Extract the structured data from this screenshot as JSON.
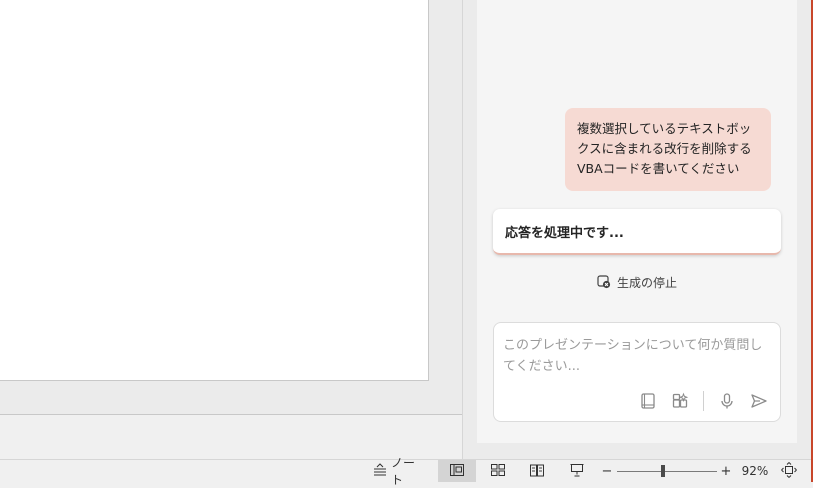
{
  "copilot": {
    "user_message": "複数選択しているテキストボックスに含まれる改行を削除するVBAコードを書いてください",
    "response_status": "応答を処理中です...",
    "stop_label": "生成の停止",
    "input_placeholder": "このプレゼンテーションについて何か質問してください..."
  },
  "status_bar": {
    "notes_label": "ノート",
    "zoom_out": "−",
    "zoom_in": "+",
    "zoom_level": "92%",
    "zoom_percent": 92
  },
  "colors": {
    "user_bubble": "#f6dad3",
    "accent": "#c8462a"
  },
  "icons": {
    "stop": "stop-generating-icon",
    "notebook": "notebook-icon",
    "prompt_gallery": "prompt-gallery-icon",
    "microphone": "microphone-icon",
    "send": "send-icon",
    "notes": "notes-icon",
    "normal_view": "normal-view-icon",
    "slide_sorter": "slide-sorter-icon",
    "reading_view": "reading-view-icon",
    "slideshow": "slideshow-icon",
    "fit_to_window": "fit-to-window-icon"
  }
}
